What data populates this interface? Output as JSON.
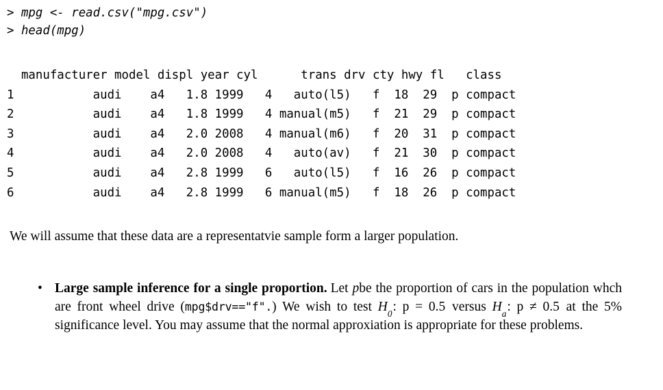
{
  "console": {
    "lines": [
      "> mpg <- read.csv(\"mpg.csv\")",
      "> head(mpg)"
    ]
  },
  "dataframe": {
    "columns": [
      "manufacturer",
      "model",
      "displ",
      "year",
      "cyl",
      "trans",
      "drv",
      "cty",
      "hwy",
      "fl",
      "class"
    ],
    "header_line": "  manufacturer model displ year cyl      trans drv cty hwy fl   class",
    "rows": [
      {
        "index": "1",
        "manufacturer": "audi",
        "model": "a4",
        "displ": "1.8",
        "year": "1999",
        "cyl": "4",
        "trans": "auto(l5)",
        "drv": "f",
        "cty": "18",
        "hwy": "29",
        "fl": "p",
        "class": "compact",
        "line": "1           audi    a4   1.8 1999   4   auto(l5)   f  18  29  p compact"
      },
      {
        "index": "2",
        "manufacturer": "audi",
        "model": "a4",
        "displ": "1.8",
        "year": "1999",
        "cyl": "4",
        "trans": "manual(m5)",
        "drv": "f",
        "cty": "21",
        "hwy": "29",
        "fl": "p",
        "class": "compact",
        "line": "2           audi    a4   1.8 1999   4 manual(m5)   f  21  29  p compact"
      },
      {
        "index": "3",
        "manufacturer": "audi",
        "model": "a4",
        "displ": "2.0",
        "year": "2008",
        "cyl": "4",
        "trans": "manual(m6)",
        "drv": "f",
        "cty": "20",
        "hwy": "31",
        "fl": "p",
        "class": "compact",
        "line": "3           audi    a4   2.0 2008   4 manual(m6)   f  20  31  p compact"
      },
      {
        "index": "4",
        "manufacturer": "audi",
        "model": "a4",
        "displ": "2.0",
        "year": "2008",
        "cyl": "4",
        "trans": "auto(av)",
        "drv": "f",
        "cty": "21",
        "hwy": "30",
        "fl": "p",
        "class": "compact",
        "line": "4           audi    a4   2.0 2008   4   auto(av)   f  21  30  p compact"
      },
      {
        "index": "5",
        "manufacturer": "audi",
        "model": "a4",
        "displ": "2.8",
        "year": "1999",
        "cyl": "6",
        "trans": "auto(l5)",
        "drv": "f",
        "cty": "16",
        "hwy": "26",
        "fl": "p",
        "class": "compact",
        "line": "5           audi    a4   2.8 1999   6   auto(l5)   f  16  26  p compact"
      },
      {
        "index": "6",
        "manufacturer": "audi",
        "model": "a4",
        "displ": "2.8",
        "year": "1999",
        "cyl": "6",
        "trans": "manual(m5)",
        "drv": "f",
        "cty": "18",
        "hwy": "26",
        "fl": "p",
        "class": "compact",
        "line": "6           audi    a4   2.8 1999   6 manual(m5)   f  18  26  p compact"
      }
    ]
  },
  "prose": {
    "paragraph": "We will assume that these data are a representatvie sample form a larger population."
  },
  "item": {
    "bullet_glyph": "•",
    "lead_in": "Large sample inference for a single proportion.",
    "text_1": "Let",
    "math_p": "p",
    "text_2": "be the proportion of cars in the population whch are front wheel drive (",
    "code_drv": "mpg$drv==\"f\".",
    "text_3": ")",
    "text_4": "We wish to test",
    "math_h0": "H",
    "math_h0_sub": "0",
    "math_h0_rest": ": p = 0.5",
    "text_5": "versus",
    "math_ha": "H",
    "math_ha_sub": "a",
    "math_ha_rest": ": p ≠ 0.5",
    "text_6": "at the 5% significance level.",
    "text_7": "You may assume that the normal approxiation is appropriate for these problems."
  }
}
